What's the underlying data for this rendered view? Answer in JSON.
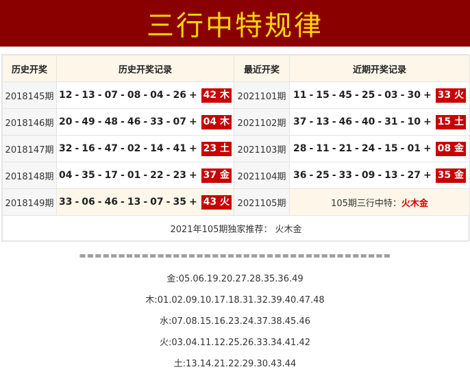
{
  "title": "三行中特规律",
  "headers": [
    "历史开奖",
    "历史开奖记录",
    "最近开奖",
    "近期开奖记录"
  ],
  "rows": [
    {
      "hist_period": "2018145期",
      "hist_nums": [
        "12",
        "13",
        "07",
        "08",
        "04",
        "26"
      ],
      "hist_special": "42 木",
      "recent_period": "2021101期",
      "recent_nums": [
        "11",
        "15",
        "45",
        "25",
        "03",
        "30"
      ],
      "recent_special": "33 火"
    },
    {
      "hist_period": "2018146期",
      "hist_nums": [
        "20",
        "49",
        "48",
        "46",
        "33",
        "07"
      ],
      "hist_special": "04 木",
      "recent_period": "2021102期",
      "recent_nums": [
        "37",
        "13",
        "46",
        "40",
        "31",
        "10"
      ],
      "recent_special": "15 土"
    },
    {
      "hist_period": "2018147期",
      "hist_nums": [
        "32",
        "16",
        "47",
        "02",
        "14",
        "41"
      ],
      "hist_special": "23 土",
      "recent_period": "2021103期",
      "recent_nums": [
        "28",
        "11",
        "21",
        "24",
        "15",
        "01"
      ],
      "recent_special": "08 金"
    },
    {
      "hist_period": "2018148期",
      "hist_nums": [
        "04",
        "35",
        "17",
        "01",
        "22",
        "23"
      ],
      "hist_special": "37 金",
      "recent_period": "2021104期",
      "recent_nums": [
        "36",
        "25",
        "33",
        "09",
        "13",
        "27"
      ],
      "recent_special": "35 金"
    }
  ],
  "last_row": {
    "hist_period": "2018149期",
    "hist_nums": [
      "33",
      "06",
      "46",
      "13",
      "07",
      "35"
    ],
    "hist_special": "43 火",
    "recent_period": "2021105期",
    "prediction_prefix": "105期三行中特：",
    "prediction_value": "火木金"
  },
  "recommend": "2021年105期独家推荐：  火木金",
  "divider": "========================================",
  "elements": [
    "金:05.06.19.20.27.28.35.36.49",
    "木:01.02.09.10.17.18.31.32.39.40.47.48",
    "水:07.08.15.16.23.24.37.38.45.46",
    "火:03.04.11.12.25.26.33.34.41.42",
    "土:13.14.21.22.29.30.43.44"
  ],
  "colors": {
    "banner_bg": "#8a0000",
    "banner_text": "#ffd800",
    "special_bg": "#c80000",
    "highlight_bg": "#fdf6e9"
  }
}
